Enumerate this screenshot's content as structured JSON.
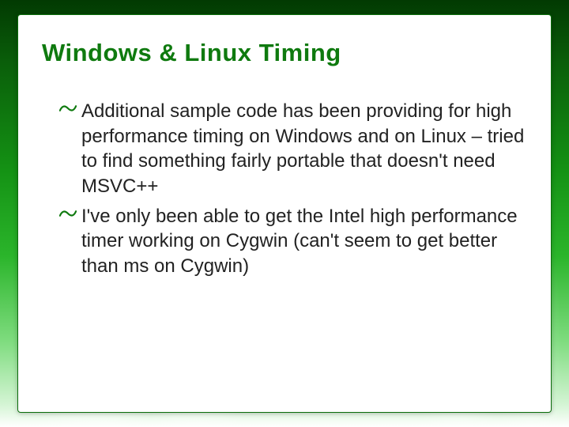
{
  "title": "Windows & Linux Timing",
  "bullets": [
    "Additional sample code has been providing for high performance timing on Windows and on Linux – tried to find something fairly portable that doesn't need MSVC++",
    "I've only been able to get the Intel high performance timer working on Cygwin (can't seem to get better than ms on Cygwin)"
  ],
  "colors": {
    "title": "#0f7a0f",
    "text": "#222222",
    "card_border": "#0a6e0a"
  }
}
